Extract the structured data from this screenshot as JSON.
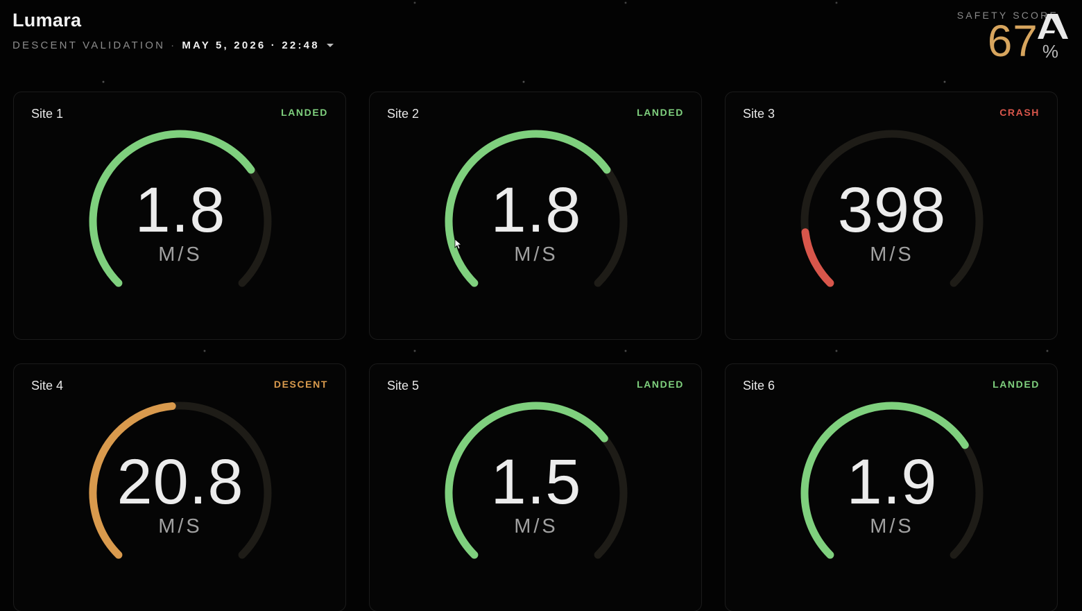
{
  "app": {
    "title": "Lumara",
    "subtitle": "DESCENT VALIDATION",
    "separator": "·",
    "date": "MAY 5, 2026 · 22:48"
  },
  "safety": {
    "label": "SAFETY SCORE",
    "value": "67",
    "unit": "%"
  },
  "colors": {
    "green": "#7fd07e",
    "orange": "#d99a4d",
    "red": "#d8564b",
    "track": "#1e1c17"
  },
  "cards": [
    {
      "title": "Site 1",
      "status": "LANDED",
      "status_color": "#7fd07e",
      "value": "1.8",
      "unit": "M/S",
      "fill": 0.7,
      "arc_color": "#7fd07e"
    },
    {
      "title": "Site 2",
      "status": "LANDED",
      "status_color": "#7fd07e",
      "value": "1.8",
      "unit": "M/S",
      "fill": 0.7,
      "arc_color": "#7fd07e"
    },
    {
      "title": "Site 3",
      "status": "CRASH",
      "status_color": "#d8564b",
      "value": "398",
      "unit": "M/S",
      "fill": 0.14,
      "arc_color": "#d8564b"
    },
    {
      "title": "Site 4",
      "status": "DESCENT",
      "status_color": "#d99a4d",
      "value": "20.8",
      "unit": "M/S",
      "fill": 0.48,
      "arc_color": "#d99a4d"
    },
    {
      "title": "Site 5",
      "status": "LANDED",
      "status_color": "#7fd07e",
      "value": "1.5",
      "unit": "M/S",
      "fill": 0.69,
      "arc_color": "#7fd07e"
    },
    {
      "title": "Site 6",
      "status": "LANDED",
      "status_color": "#7fd07e",
      "value": "1.9",
      "unit": "M/S",
      "fill": 0.71,
      "arc_color": "#7fd07e"
    }
  ]
}
